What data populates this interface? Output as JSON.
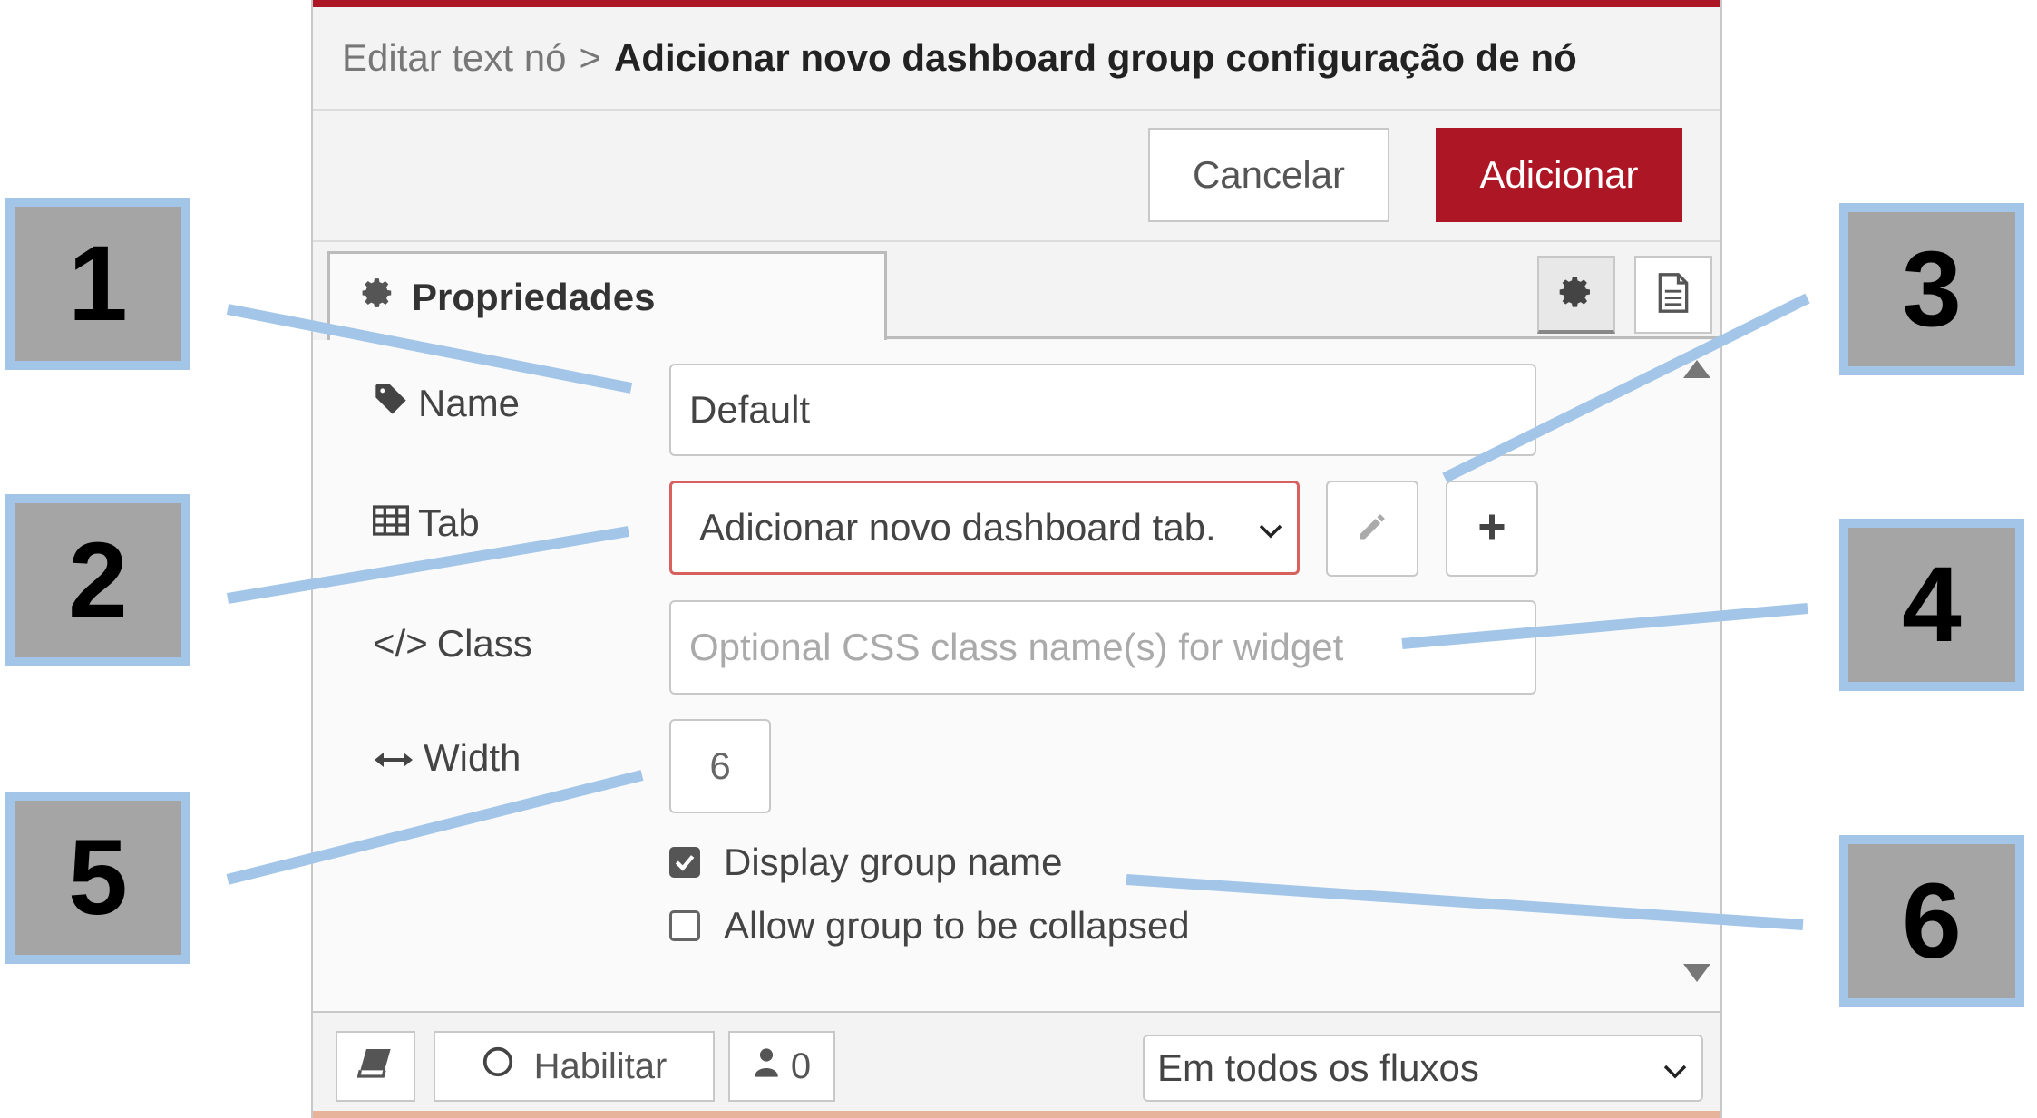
{
  "header": {
    "breadcrumb_parent": "Editar text nó",
    "breadcrumb_separator": ">",
    "breadcrumb_current": "Adicionar novo dashboard group configuração de nó"
  },
  "actions": {
    "cancel_label": "Cancelar",
    "add_label": "Adicionar"
  },
  "tabs": {
    "properties_label": "Propriedades",
    "properties_icon": "gear-icon",
    "right_icons": [
      "gear-icon",
      "document-icon"
    ]
  },
  "form": {
    "name": {
      "label": "Name",
      "icon": "tag-icon",
      "value": "Default"
    },
    "tab": {
      "label": "Tab",
      "icon": "table-icon",
      "selected": "Adicionar novo dashboard tab.",
      "edit_icon": "pencil-icon",
      "add_icon": "plus-icon"
    },
    "class": {
      "label": "Class",
      "icon": "code-icon",
      "icon_text": "</>",
      "value": "",
      "placeholder": "Optional CSS class name(s) for widget"
    },
    "width": {
      "label": "Width",
      "icon": "arrows-horizontal-icon",
      "value": "6"
    },
    "display_group_name": {
      "label": "Display group name",
      "checked": true
    },
    "allow_collapse": {
      "label": "Allow group to be collapsed",
      "checked": false
    }
  },
  "footer": {
    "help_icon": "book-icon",
    "enable_label": "Habilitar",
    "enable_icon": "circle-icon",
    "users_icon": "user-icon",
    "users_count": "0",
    "scope_selected": "Em todos os fluxos"
  },
  "callouts": [
    "1",
    "2",
    "3",
    "4",
    "5",
    "6"
  ],
  "colors": {
    "accent": "#ad1625",
    "callout_fill": "#a5a5a5",
    "callout_border": "#a3c6e8",
    "error_border": "#d6615e"
  }
}
